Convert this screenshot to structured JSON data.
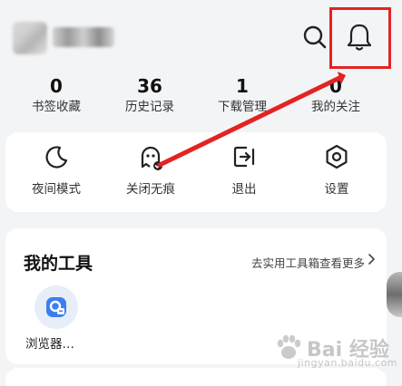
{
  "stats": [
    {
      "value": "0",
      "label": "书签收藏"
    },
    {
      "value": "36",
      "label": "历史记录"
    },
    {
      "value": "1",
      "label": "下载管理"
    },
    {
      "value": "0",
      "label": "我的关注"
    }
  ],
  "actions": [
    {
      "label": "夜间模式",
      "icon": "moon-icon"
    },
    {
      "label": "关闭无痕",
      "icon": "ghost-icon"
    },
    {
      "label": "退出",
      "icon": "logout-icon"
    },
    {
      "label": "设置",
      "icon": "settings-icon"
    }
  ],
  "tools": {
    "title": "我的工具",
    "link": "去实用工具箱查看更多",
    "items": [
      {
        "label": "浏览器…",
        "icon": "browser-icon"
      }
    ]
  },
  "watermark": {
    "text": "Bai 经验",
    "subtext": "jingyan.baidu.com"
  },
  "colors": {
    "annotation": "#e32323",
    "card": "#ffffff",
    "background": "#f3f4f6",
    "tool_icon": "#3b7ef0"
  }
}
